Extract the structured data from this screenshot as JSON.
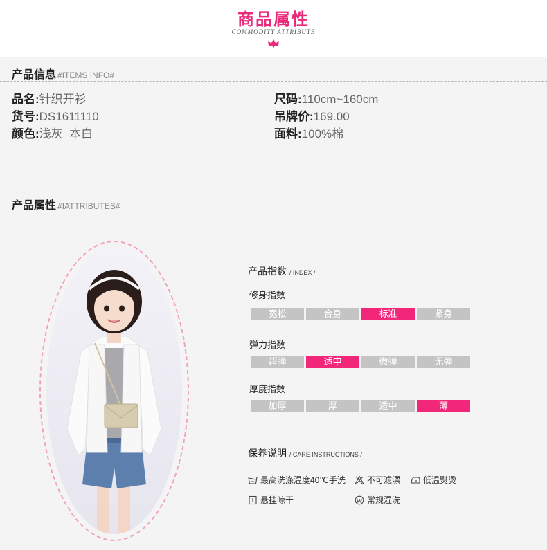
{
  "header": {
    "title": "商品属性",
    "subtitle": "COMMODITY ATTRIBUTE",
    "accent_color": "#ea2a7a"
  },
  "items_info": {
    "heading": "产品信息",
    "tag": "#ITEMS INFO#",
    "left": [
      {
        "label": "品名:",
        "value": "针织开衫"
      },
      {
        "label": "货号:",
        "value": "DS1611110"
      },
      {
        "label": "颜色:",
        "value": "浅灰  本白"
      }
    ],
    "right": [
      {
        "label": "尺码:",
        "value": "110cm~160cm"
      },
      {
        "label": "吊牌价:",
        "value": "169.00"
      },
      {
        "label": "面料:",
        "value": "100%棉"
      }
    ]
  },
  "attributes": {
    "heading": "产品属性",
    "tag": "#IATTRIBUTES#"
  },
  "index_panel": {
    "title": "产品指数",
    "tag": "/ INDEX /",
    "active_color": "#f2277a",
    "inactive_color": "#c4c4c4",
    "groups": [
      {
        "label": "修身指数",
        "options": [
          "宽松",
          "合身",
          "标准",
          "紧身"
        ],
        "selected": 2
      },
      {
        "label": "弹力指数",
        "options": [
          "超弹",
          "适中",
          "微弹",
          "无弹"
        ],
        "selected": 1
      },
      {
        "label": "厚度指数",
        "options": [
          "加厚",
          "厚",
          "适中",
          "薄"
        ],
        "selected": 3
      }
    ]
  },
  "care": {
    "title": "保养说明",
    "tag": "/ CARE INSTRUCTIONS /",
    "items": [
      {
        "icon": "wash-tub-icon",
        "text": "最高洗涤温度40℃手洗"
      },
      {
        "icon": "no-bleach-icon",
        "text": "不可滤漂"
      },
      {
        "icon": "iron-low-icon",
        "text": "低温熨烫"
      },
      {
        "icon": "hang-dry-icon",
        "text": "悬挂晾干"
      },
      {
        "icon": "wet-clean-icon",
        "text": "常规湿洗"
      }
    ]
  }
}
